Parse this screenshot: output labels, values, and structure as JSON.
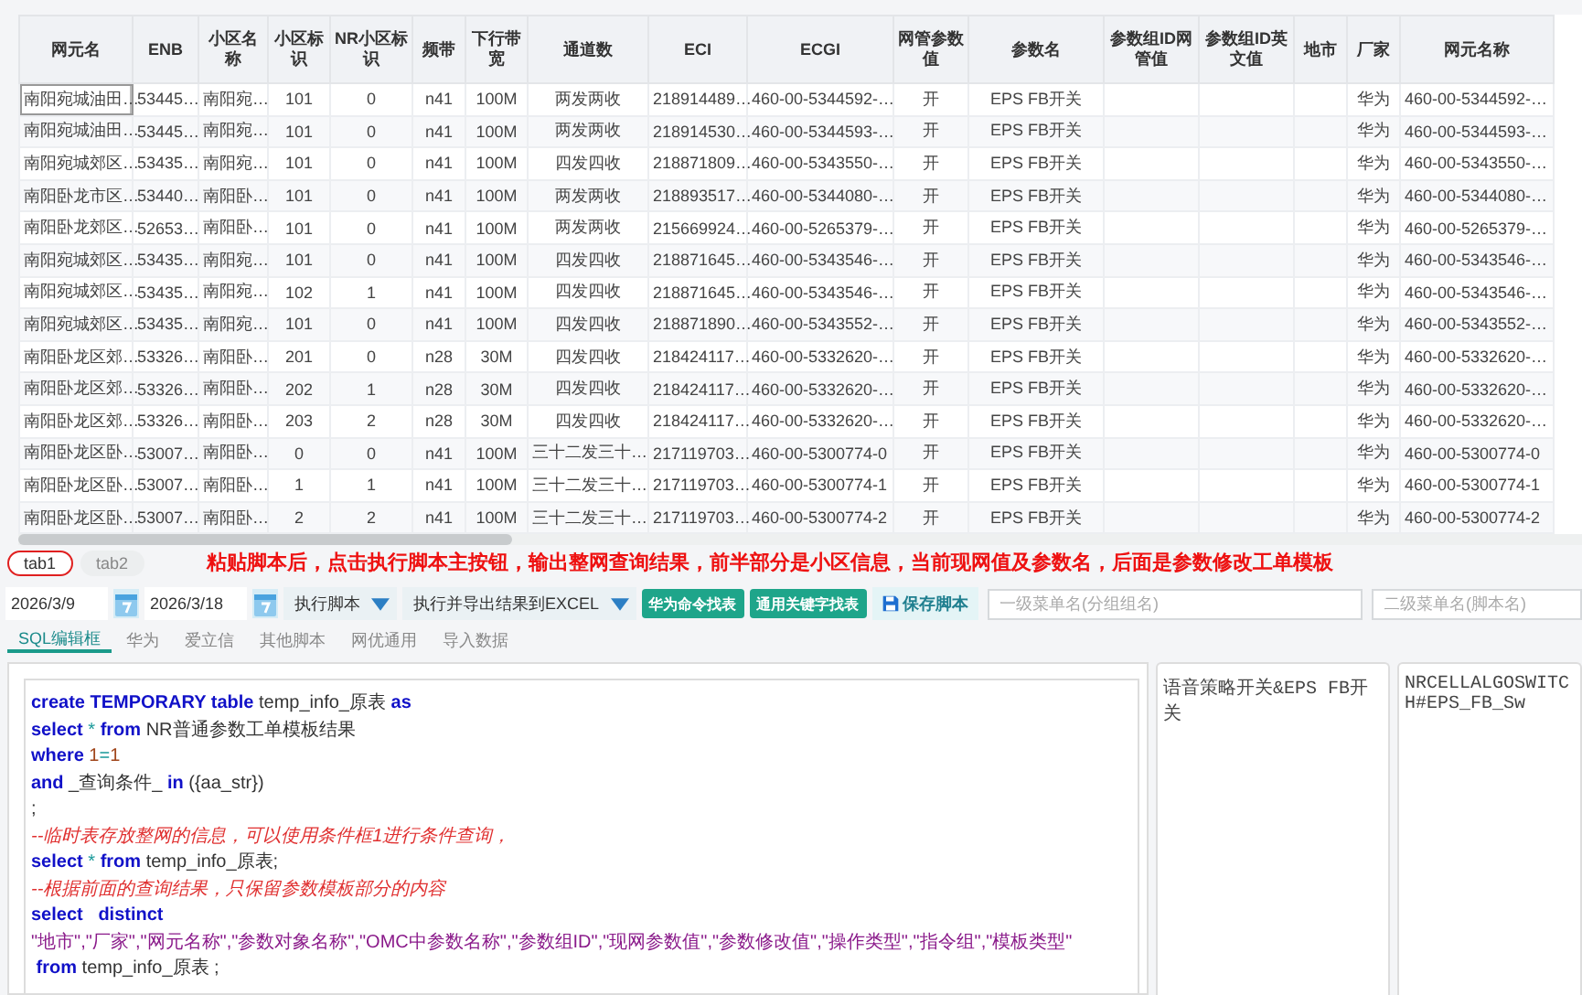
{
  "table": {
    "columns": [
      "网元名",
      "ENB",
      "小区名称",
      "小区标识",
      "NR小区标识",
      "频带",
      "下行带宽",
      "通道数",
      "ECI",
      "ECGI",
      "网管参数值",
      "参数名",
      "参数组ID网管值",
      "参数组ID英文值",
      "地市",
      "厂家",
      "网元名称"
    ],
    "rows": [
      {
        "focused": true,
        "cells": [
          "南阳宛城油田…",
          "53445…",
          "南阳宛…",
          "101",
          "0",
          "n41",
          "100M",
          "两发两收",
          "218914489…",
          "460-00-5344592-…",
          "开",
          "EPS FB开关",
          null,
          null,
          null,
          "华为",
          "460-00-5344592-…"
        ]
      },
      {
        "focused": false,
        "cells": [
          "南阳宛城油田…",
          "53445…",
          "南阳宛…",
          "101",
          "0",
          "n41",
          "100M",
          "两发两收",
          "218914530…",
          "460-00-5344593-…",
          "开",
          "EPS FB开关",
          null,
          null,
          null,
          "华为",
          "460-00-5344593-…"
        ]
      },
      {
        "focused": false,
        "cells": [
          "南阳宛城郊区…",
          "53435…",
          "南阳宛…",
          "101",
          "0",
          "n41",
          "100M",
          "四发四收",
          "218871809…",
          "460-00-5343550-…",
          "开",
          "EPS FB开关",
          null,
          null,
          null,
          "华为",
          "460-00-5343550-…"
        ]
      },
      {
        "focused": false,
        "cells": [
          "南阳卧龙市区…",
          "53440…",
          "南阳卧…",
          "101",
          "0",
          "n41",
          "100M",
          "两发两收",
          "218893517…",
          "460-00-5344080-…",
          "开",
          "EPS FB开关",
          null,
          null,
          null,
          "华为",
          "460-00-5344080-…"
        ]
      },
      {
        "focused": false,
        "cells": [
          "南阳卧龙郊区…",
          "52653…",
          "南阳卧…",
          "101",
          "0",
          "n41",
          "100M",
          "两发两收",
          "215669924…",
          "460-00-5265379-…",
          "开",
          "EPS FB开关",
          null,
          null,
          null,
          "华为",
          "460-00-5265379-…"
        ]
      },
      {
        "focused": false,
        "cells": [
          "南阳宛城郊区…",
          "53435…",
          "南阳宛…",
          "101",
          "0",
          "n41",
          "100M",
          "四发四收",
          "218871645…",
          "460-00-5343546-…",
          "开",
          "EPS FB开关",
          null,
          null,
          null,
          "华为",
          "460-00-5343546-…"
        ]
      },
      {
        "focused": false,
        "cells": [
          "南阳宛城郊区…",
          "53435…",
          "南阳宛…",
          "102",
          "1",
          "n41",
          "100M",
          "四发四收",
          "218871645…",
          "460-00-5343546-…",
          "开",
          "EPS FB开关",
          null,
          null,
          null,
          "华为",
          "460-00-5343546-…"
        ]
      },
      {
        "focused": false,
        "cells": [
          "南阳宛城郊区…",
          "53435…",
          "南阳宛…",
          "101",
          "0",
          "n41",
          "100M",
          "四发四收",
          "218871890…",
          "460-00-5343552-…",
          "开",
          "EPS FB开关",
          null,
          null,
          null,
          "华为",
          "460-00-5343552-…"
        ]
      },
      {
        "focused": false,
        "cells": [
          "南阳卧龙区郊…",
          "53326…",
          "南阳卧…",
          "201",
          "0",
          "n28",
          "30M",
          "四发四收",
          "218424117…",
          "460-00-5332620-…",
          "开",
          "EPS FB开关",
          null,
          null,
          null,
          "华为",
          "460-00-5332620-…"
        ]
      },
      {
        "focused": false,
        "cells": [
          "南阳卧龙区郊…",
          "53326…",
          "南阳卧…",
          "202",
          "1",
          "n28",
          "30M",
          "四发四收",
          "218424117…",
          "460-00-5332620-…",
          "开",
          "EPS FB开关",
          null,
          null,
          null,
          "华为",
          "460-00-5332620-…"
        ]
      },
      {
        "focused": false,
        "cells": [
          "南阳卧龙区郊…",
          "53326…",
          "南阳卧…",
          "203",
          "2",
          "n28",
          "30M",
          "四发四收",
          "218424117…",
          "460-00-5332620-…",
          "开",
          "EPS FB开关",
          null,
          null,
          null,
          "华为",
          "460-00-5332620-…"
        ]
      },
      {
        "focused": false,
        "cells": [
          "南阳卧龙区卧…",
          "53007…",
          "南阳卧…",
          "0",
          "0",
          "n41",
          "100M",
          "三十二发三十…",
          "217119703…",
          "460-00-5300774-0",
          "开",
          "EPS FB开关",
          null,
          null,
          null,
          "华为",
          "460-00-5300774-0"
        ]
      },
      {
        "focused": false,
        "cells": [
          "南阳卧龙区卧…",
          "53007…",
          "南阳卧…",
          "1",
          "1",
          "n41",
          "100M",
          "三十二发三十…",
          "217119703…",
          "460-00-5300774-1",
          "开",
          "EPS FB开关",
          null,
          null,
          null,
          "华为",
          "460-00-5300774-1"
        ]
      },
      {
        "focused": false,
        "cells": [
          "南阳卧龙区卧…",
          "53007…",
          "南阳卧…",
          "2",
          "2",
          "n41",
          "100M",
          "三十二发三十…",
          "217119703…",
          "460-00-5300774-2",
          "开",
          "EPS FB开关",
          null,
          null,
          null,
          "华为",
          "460-00-5300774-2"
        ]
      }
    ]
  },
  "result_tabs": [
    {
      "label": "tab1",
      "selected": true
    },
    {
      "label": "tab2",
      "selected": false
    }
  ],
  "annotation": "粘贴脚本后，点击执行脚本主按钮，输出整网查询结果，前半部分是小区信息，当前现网值及参数名，后面是参数修改工单模板",
  "toolbar": {
    "start_date": "2026/3/9",
    "end_date": "2026/3/18",
    "items": [
      {
        "kind": "split",
        "label": "执行脚本"
      },
      {
        "kind": "split",
        "label": "执行并导出结果到EXCEL"
      },
      {
        "kind": "teal",
        "label": "华为命令找表"
      },
      {
        "kind": "teal",
        "label": "通用关键字找表"
      },
      {
        "kind": "save",
        "label": "保存脚本"
      }
    ],
    "menu_fields": [
      {
        "placeholder": "一级菜单名(分组组名)"
      },
      {
        "placeholder": "二级菜单名(脚本名)"
      }
    ]
  },
  "editor_tabs": [
    {
      "label": "SQL编辑框",
      "selected": true
    },
    {
      "label": "华为",
      "selected": false
    },
    {
      "label": "爱立信",
      "selected": false
    },
    {
      "label": "其他脚本",
      "selected": false
    },
    {
      "label": "网优通用",
      "selected": false
    },
    {
      "label": "导入数据",
      "selected": false
    }
  ],
  "code_lines": [
    [
      {
        "kind": "keyword",
        "text": "create TEMPORARY table"
      },
      {
        "kind": "plain",
        "text": " temp_info_原表 "
      },
      {
        "kind": "keyword",
        "text": "as"
      }
    ],
    [
      {
        "kind": "keyword",
        "text": "select"
      },
      {
        "kind": "operator",
        "text": " * "
      },
      {
        "kind": "keyword",
        "text": "from"
      },
      {
        "kind": "plain",
        "text": " NR普通参数工单模板结果"
      }
    ],
    [
      {
        "kind": "keyword",
        "text": "where"
      },
      {
        "kind": "number",
        "text": " 1"
      },
      {
        "kind": "operator",
        "text": "="
      },
      {
        "kind": "number",
        "text": "1"
      }
    ],
    [
      {
        "kind": "keyword",
        "text": "and"
      },
      {
        "kind": "plain",
        "text": " _查询条件_ "
      },
      {
        "kind": "keyword",
        "text": "in"
      },
      {
        "kind": "plain",
        "text": " ({aa_str})"
      }
    ],
    [
      {
        "kind": "plain",
        "text": ";"
      }
    ],
    [
      {
        "kind": "comment",
        "text": "--临时表存放整网的信息，可以使用条件框1进行条件查询，"
      }
    ],
    [
      {
        "kind": "keyword",
        "text": "select"
      },
      {
        "kind": "operator",
        "text": " * "
      },
      {
        "kind": "keyword",
        "text": "from"
      },
      {
        "kind": "plain",
        "text": " temp_info_原表;"
      }
    ],
    [
      {
        "kind": "comment",
        "text": "--根据前面的查询结果，只保留参数模板部分的内容"
      }
    ],
    [
      {
        "kind": "keyword",
        "text": "select   distinct"
      }
    ],
    [
      {
        "kind": "string",
        "text": "\"地市\",\"厂家\",\"网元名称\",\"参数对象名称\",\"OMC中参数名称\",\"参数组ID\",\"现网参数值\",\"参数修改值\",\"操作类型\",\"指令组\",\"模板类型\""
      }
    ],
    [
      {
        "kind": "keyword",
        "text": " from"
      },
      {
        "kind": "plain",
        "text": " temp_info_原表 ;"
      }
    ]
  ],
  "side_panels": [
    "语音策略开关&EPS FB开关",
    "NRCELLALGOSWITCH#EPS_FB_Sw"
  ]
}
